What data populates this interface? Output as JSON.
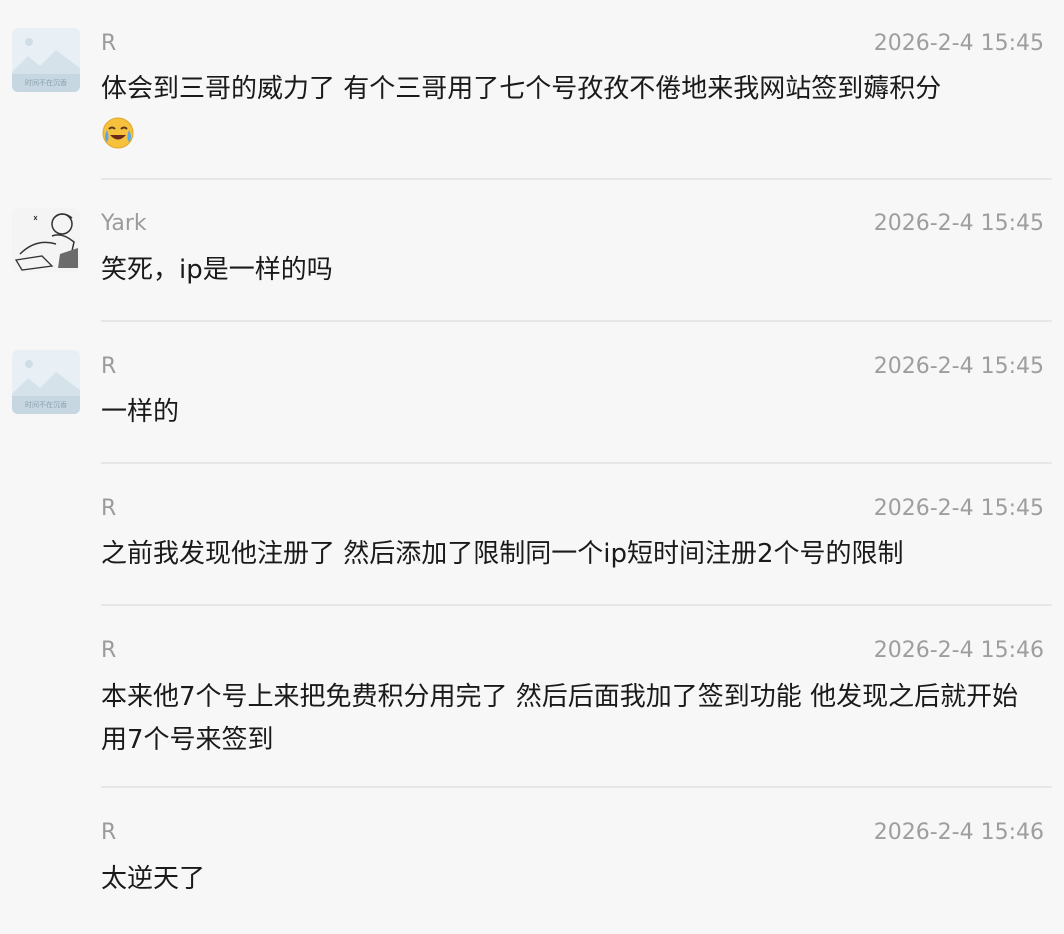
{
  "messages": [
    {
      "sender": "R",
      "time": "2026-2-4 15:45",
      "text": "体会到三哥的威力了   有个三哥用了七个号孜孜不倦地来我网站签到薅积分",
      "emoji": "loudly-crying-laughing-emoji",
      "avatar": "landscape-placeholder",
      "avatar_caption": "时间不在沉香"
    },
    {
      "sender": "Yark",
      "time": "2026-2-4 15:45",
      "text": "笑死，ip是一样的吗",
      "avatar": "sketch-character-avatar"
    },
    {
      "sender": "R",
      "time": "2026-2-4 15:45",
      "text": "一样的",
      "avatar": "landscape-placeholder",
      "avatar_caption": "时间不在沉香"
    },
    {
      "sender": "R",
      "time": "2026-2-4 15:45",
      "text": "之前我发现他注册了  然后添加了限制同一个ip短时间注册2个号的限制"
    },
    {
      "sender": "R",
      "time": "2026-2-4 15:46",
      "text": "本来他7个号上来把免费积分用完了  然后后面我加了签到功能  他发现之后就开始用7个号来签到"
    },
    {
      "sender": "R",
      "time": "2026-2-4 15:46",
      "text": "太逆天了"
    }
  ],
  "colors": {
    "background": "#f7f7f7",
    "text": "#1a1a1a",
    "meta": "#9b9b9b",
    "divider": "#e7e7e7"
  }
}
